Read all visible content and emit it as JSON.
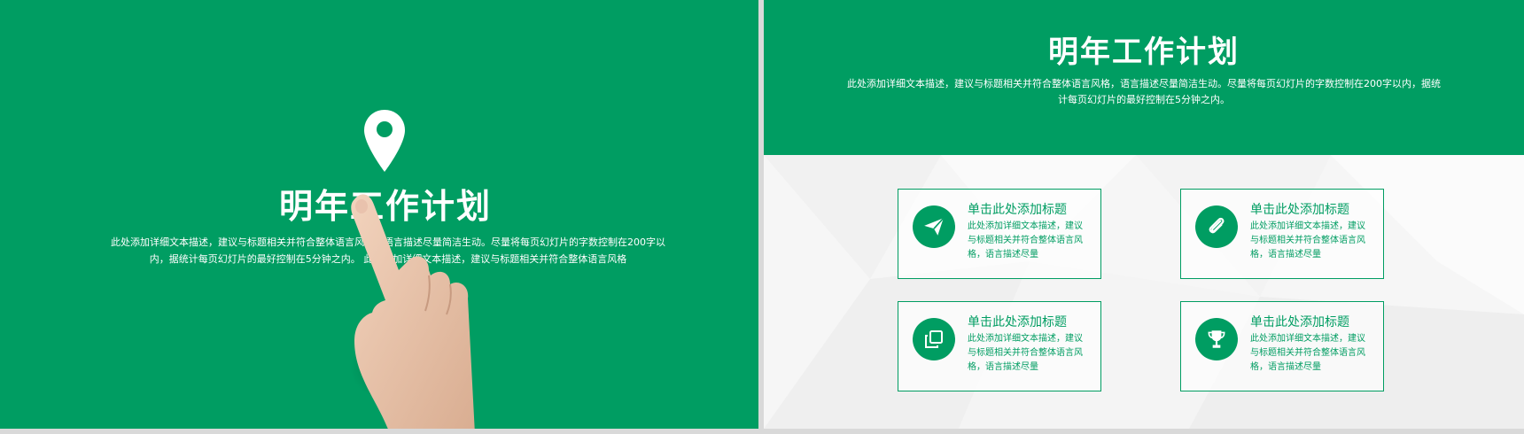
{
  "left_slide": {
    "title": "明年工作计划",
    "description": "此处添加详细文本描述，建议与标题相关并符合整体语言风格，语言描述尽量简洁生动。尽量将每页幻灯片的字数控制在200字以内，据统计每页幻灯片的最好控制在5分钟之内。 此处添加详细文本描述，建议与标题相关并符合整体语言风格",
    "icon": "location-pin-icon"
  },
  "right_slide": {
    "title": "明年工作计划",
    "description": "此处添加详细文本描述，建议与标题相关并符合整体语言风格，语言描述尽量简洁生动。尽量将每页幻灯片的字数控制在200字以内，据统计每页幻灯片的最好控制在5分钟之内。",
    "cards": [
      {
        "icon": "paper-plane-icon",
        "title": "单击此处添加标题",
        "text": "此处添加详细文本描述，建议与标题相关并符合整体语言风格，语言描述尽量"
      },
      {
        "icon": "paperclip-icon",
        "title": "单击此处添加标题",
        "text": "此处添加详细文本描述，建议与标题相关并符合整体语言风格，语言描述尽量"
      },
      {
        "icon": "copy-icon",
        "title": "单击此处添加标题",
        "text": "此处添加详细文本描述，建议与标题相关并符合整体语言风格，语言描述尽量"
      },
      {
        "icon": "trophy-icon",
        "title": "单击此处添加标题",
        "text": "此处添加详细文本描述，建议与标题相关并符合整体语言风格，语言描述尽量"
      }
    ]
  },
  "colors": {
    "accent": "#009d62",
    "text_light": "#ffffff",
    "background": "#f6f6f6"
  }
}
